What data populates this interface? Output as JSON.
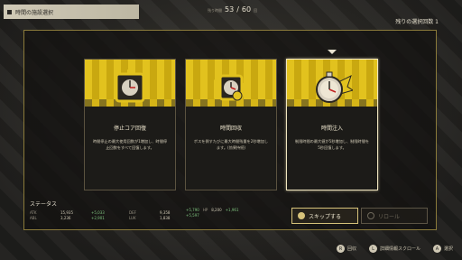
{
  "header": {
    "title": "時間の施設選択",
    "counter_label": "残り時間",
    "counter_current": "53",
    "counter_sep": "/",
    "counter_max": "60",
    "counter_unit": "回"
  },
  "remaining_label": "残りの選択回数 1",
  "cards": [
    {
      "name": "停止コア回復",
      "desc": "時間停止の最大使用回数が1増加し、時間停止回数をすべて回復します。",
      "icon": "stopwatch-core-icon",
      "selected": false
    },
    {
      "name": "時間回収",
      "desc": "ボスを倒すたびに最大時間残量を2秒増加します。(効果持続)",
      "icon": "clock-gear-icon",
      "selected": false
    },
    {
      "name": "時間注入",
      "desc": "制限時間の最大値が5秒増加し、制限時間を5秒回復します。",
      "icon": "winged-clock-icon",
      "selected": true
    }
  ],
  "status": {
    "title": "ステータス",
    "rows": [
      {
        "k": "ATK",
        "v": "15,935",
        "g": "+5,033",
        "k2": "DEF",
        "v2": "9,358",
        "g2": "+5,790"
      },
      {
        "k": "ABL",
        "v": "3,236",
        "g": "+2,901",
        "k2": "LUK",
        "v2": "1,838",
        "g2": "+5,597"
      }
    ],
    "hp_label": "HP",
    "hp_value": "8,200",
    "hp_gain": "+1,961"
  },
  "buttons": {
    "skip": "スキップする",
    "reroll": "リロール"
  },
  "hints": [
    {
      "icon": "R",
      "label": "回収"
    },
    {
      "icon": "L",
      "label": "詳細情報スクロール"
    },
    {
      "icon": "A",
      "label": "選択"
    }
  ],
  "colors": {
    "accent_gold": "#e2c21e",
    "border_gold": "#8a7a3a",
    "gain_green": "#7fc47f"
  }
}
